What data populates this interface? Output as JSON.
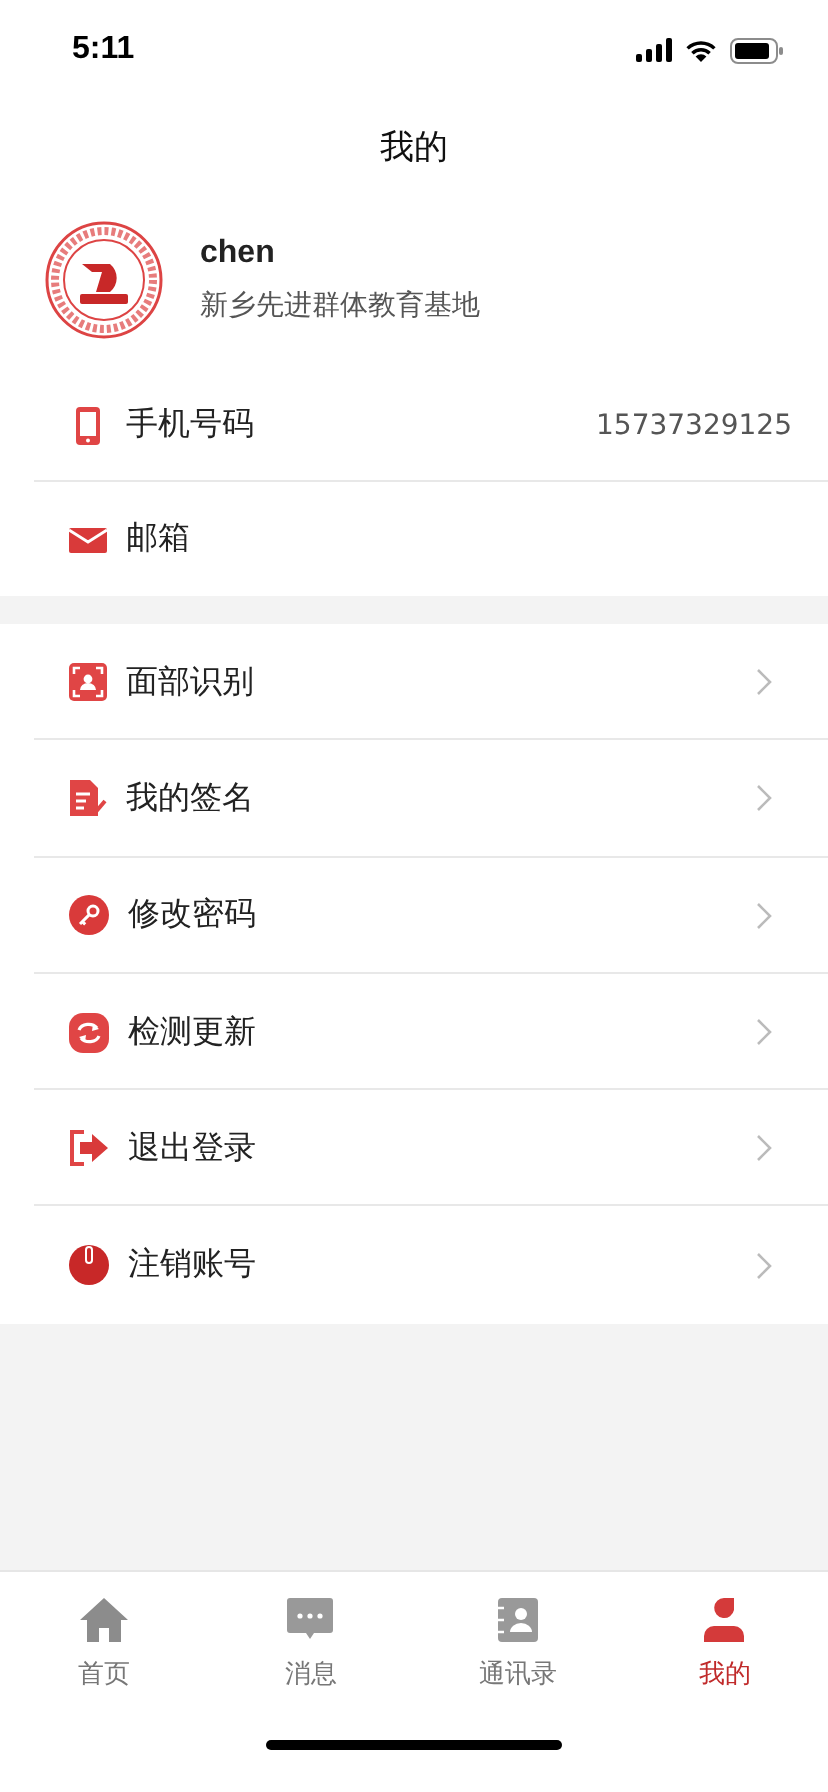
{
  "status_bar": {
    "time": "5:11"
  },
  "header": {
    "title": "我的"
  },
  "profile": {
    "name": "chen",
    "organization": "新乡先进群体教育基地"
  },
  "contact_rows": [
    {
      "label": "手机号码",
      "value": "15737329125"
    },
    {
      "label": "邮箱"
    }
  ],
  "menu": [
    {
      "label": "面部识别"
    },
    {
      "label": "我的签名"
    },
    {
      "label": "修改密码"
    },
    {
      "label": "检测更新"
    },
    {
      "label": "退出登录"
    },
    {
      "label": "注销账号"
    }
  ],
  "tab_bar": [
    {
      "label": "首页",
      "selected": false
    },
    {
      "label": "消息",
      "selected": false
    },
    {
      "label": "通讯录",
      "selected": false
    },
    {
      "label": "我的",
      "selected": true
    }
  ]
}
